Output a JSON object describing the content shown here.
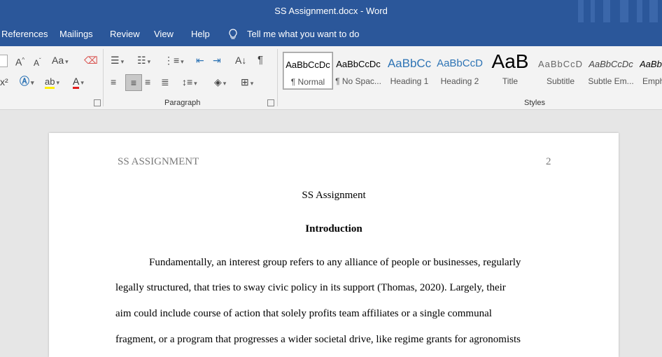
{
  "window": {
    "title": "SS Assignment.docx  -  Word"
  },
  "menu": {
    "items": [
      "References",
      "Mailings",
      "Review",
      "View",
      "Help"
    ],
    "tell_me": "Tell me what you want to do"
  },
  "ribbon": {
    "groups": {
      "paragraph": "Paragraph",
      "styles": "Styles"
    },
    "font_tools": {
      "grow": "A",
      "shrink": "A",
      "change_case": "Aa",
      "superscript": "x²",
      "highlight": "ab",
      "font_color": "A"
    },
    "styles": [
      {
        "preview": "AaBbCcDc",
        "name": "¶ Normal"
      },
      {
        "preview": "AaBbCcDc",
        "name": "¶ No Spac..."
      },
      {
        "preview": "AaBbCc",
        "name": "Heading 1"
      },
      {
        "preview": "AaBbCcD",
        "name": "Heading 2"
      },
      {
        "preview": "AaB",
        "name": "Title"
      },
      {
        "preview": "AaBbCcD",
        "name": "Subtitle"
      },
      {
        "preview": "AaBbCcDc",
        "name": "Subtle Em..."
      },
      {
        "preview": "AaBb",
        "name": "Emph"
      }
    ]
  },
  "document": {
    "header_left": "SS ASSIGNMENT",
    "header_right": "2",
    "title": "SS Assignment",
    "heading": "Introduction",
    "lines": [
      "Fundamentally, an interest group refers to any alliance of people or businesses, regularly",
      "legally structured, that tries to sway civic policy in its support (Thomas, 2020). Largely, their",
      "aim could include course of action that solely profits team affiliates or a single communal",
      "fragment, or a program that progresses a wider societal drive, like regime grants for agronomists"
    ]
  },
  "colors": {
    "brand": "#2b579a",
    "ribbon_bg": "#f3f3f3",
    "canvas": "#e6e6e6",
    "heading_blue": "#2e74b5"
  }
}
